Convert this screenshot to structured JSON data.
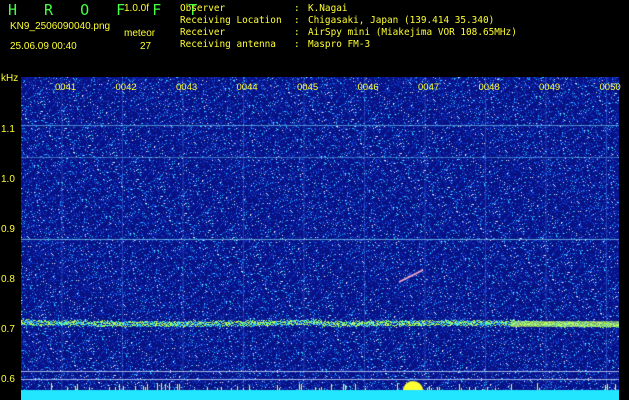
{
  "header": {
    "app_title": "H R O F F T",
    "version": "1.0.0f",
    "filename": "KN9_2506090040.png",
    "datetime": "25.06.09 00:40",
    "meteor_label": "meteor",
    "meteor_count": "27"
  },
  "info": [
    {
      "key": "Observer",
      "sep": ":",
      "value": "K.Nagai"
    },
    {
      "key": "Receiving Location",
      "sep": ":",
      "value": "Chigasaki, Japan (139.414 35.340)"
    },
    {
      "key": "Receiver",
      "sep": ":",
      "value": "AirSpy mini (Miakejima VOR 108.65MHz)"
    },
    {
      "key": "Receiving antenna",
      "sep": ":",
      "value": "Maspro FM-3"
    }
  ],
  "spectrogram": {
    "y_unit": "kHz",
    "y_ticks": [
      "1.1",
      "1.0",
      "0.9",
      "0.8",
      "0.7",
      "0.6"
    ],
    "x_ticks": [
      "0041",
      "0042",
      "0043",
      "0044",
      "0045",
      "0046",
      "0047",
      "0048",
      "0049",
      "0050"
    ],
    "colors": {
      "background": "#0a1a8c",
      "noise": "#2a7cff",
      "signal": "#b8ff4a",
      "baseline": "#22e6ff",
      "text": "#ffff33"
    }
  }
}
